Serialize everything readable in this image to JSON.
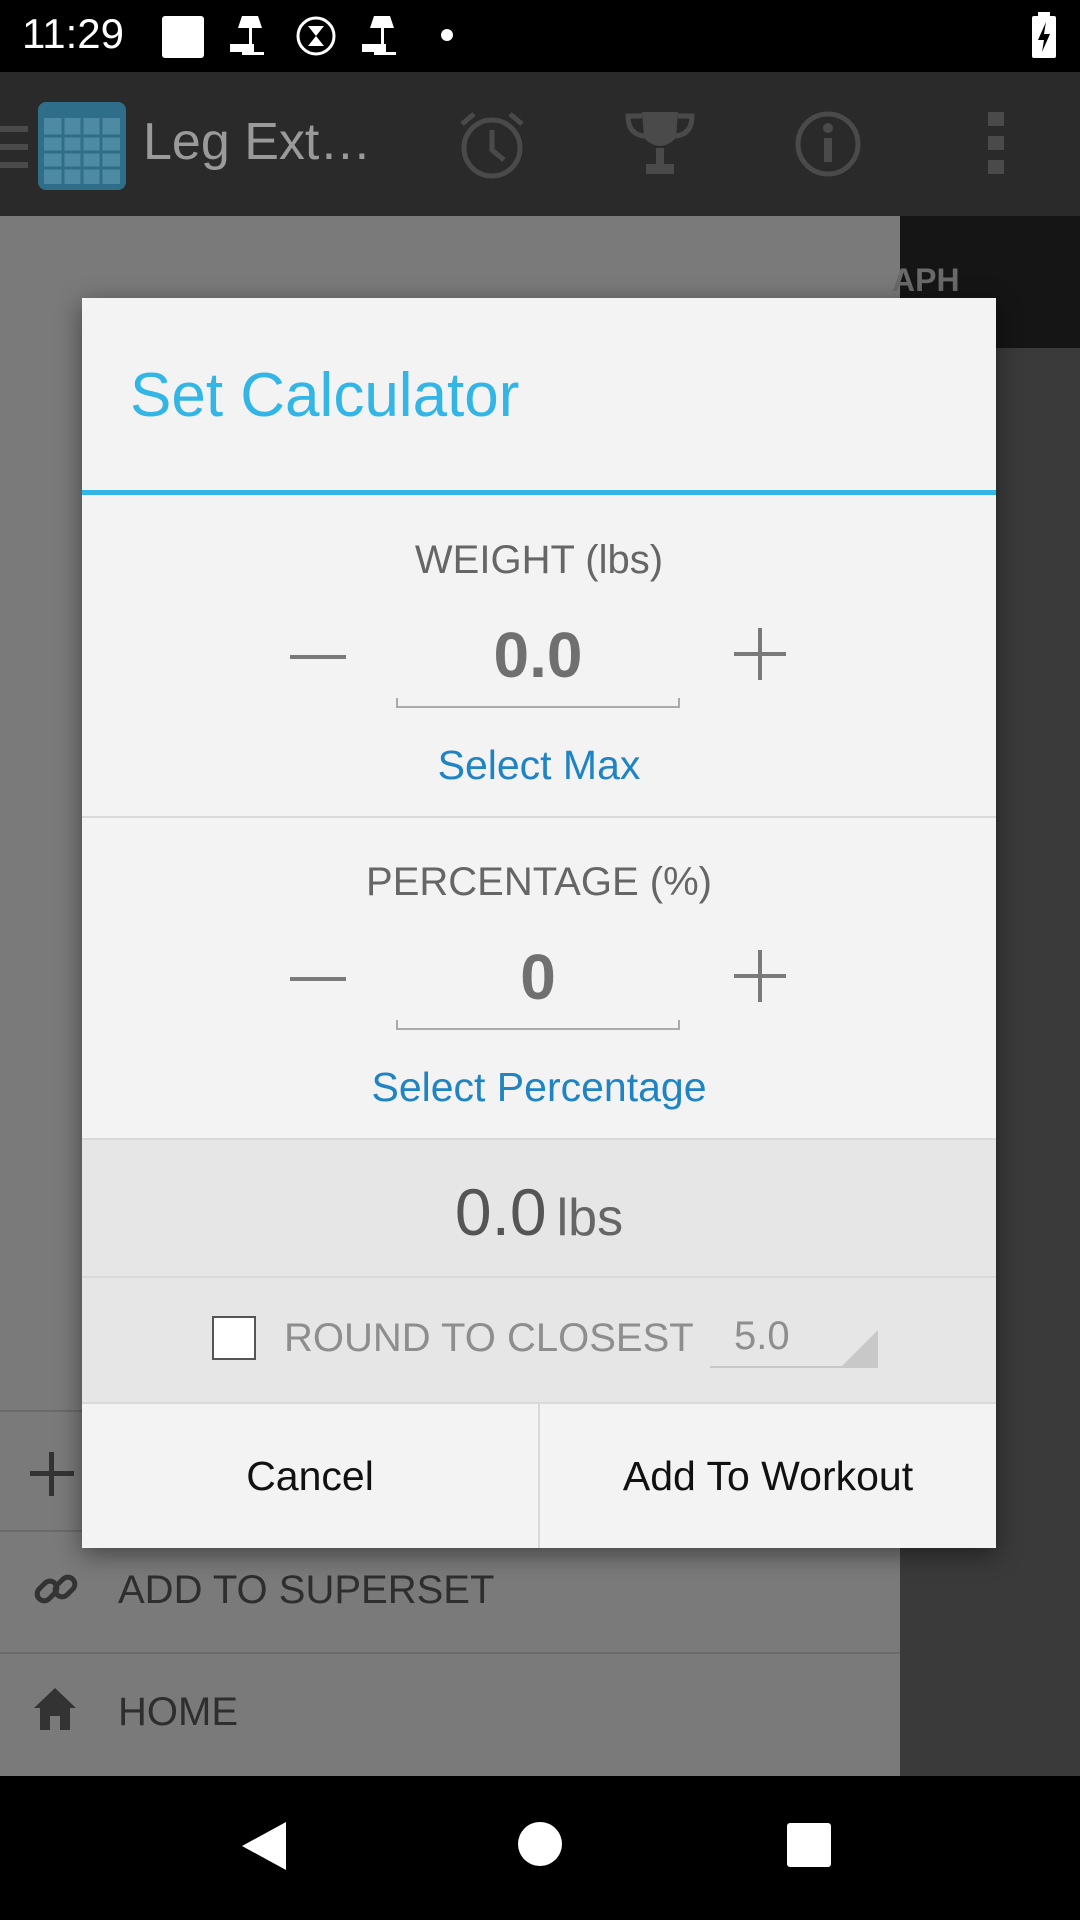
{
  "status_bar": {
    "time": "11:29"
  },
  "app_bar": {
    "title": "Leg Ext…"
  },
  "background": {
    "tab_partial": "APH",
    "row_add_superset": "ADD TO SUPERSET",
    "row_home": "HOME"
  },
  "dialog": {
    "title": "Set Calculator",
    "weight": {
      "label": "WEIGHT (lbs)",
      "value": "0.0",
      "select_link": "Select Max"
    },
    "percentage": {
      "label": "PERCENTAGE (%)",
      "value": "0",
      "select_link": "Select Percentage"
    },
    "result": {
      "value": "0.0",
      "unit": "lbs"
    },
    "round": {
      "label": "ROUND TO CLOSEST",
      "checked": false,
      "value": "5.0"
    },
    "buttons": {
      "cancel": "Cancel",
      "add": "Add To Workout"
    }
  },
  "colors": {
    "accent": "#33b5e5",
    "link": "#1f83c4"
  }
}
